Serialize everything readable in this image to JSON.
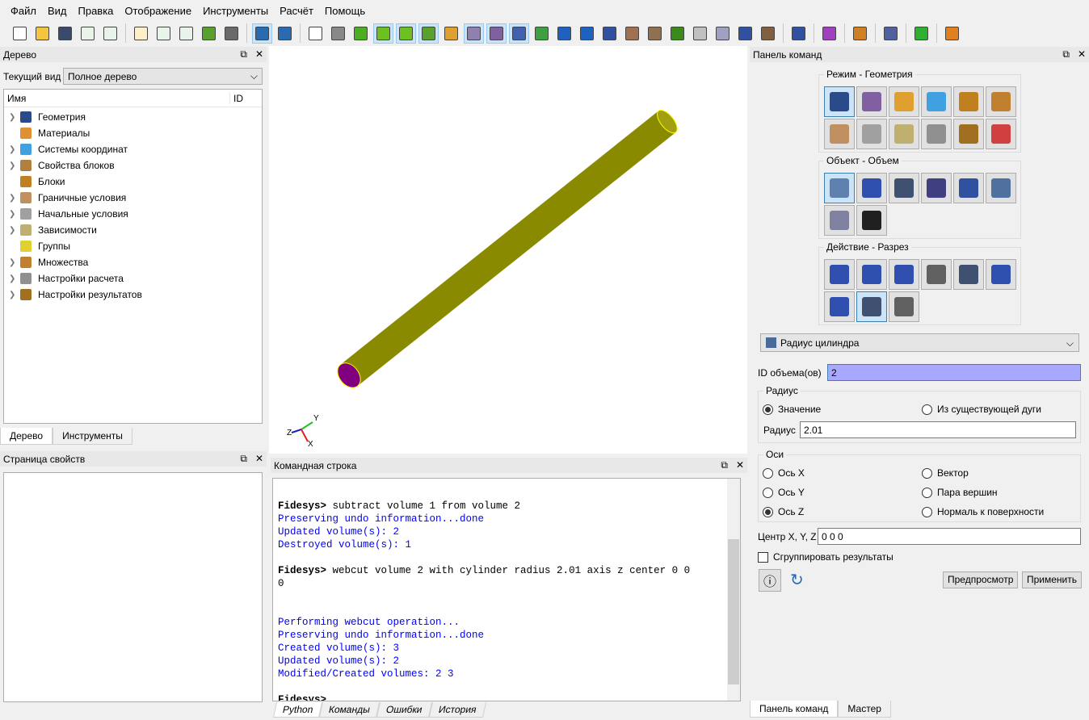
{
  "menu": [
    "Файл",
    "Вид",
    "Правка",
    "Отображение",
    "Инструменты",
    "Расчёт",
    "Помощь"
  ],
  "toolbar": {
    "icons": [
      {
        "name": "new-file-icon",
        "color": "#ffffff"
      },
      {
        "name": "open-folder-icon",
        "color": "#f5c542"
      },
      {
        "name": "save-icon",
        "color": "#3a4a6a"
      },
      {
        "name": "import-icon",
        "color": "#e8f4e8"
      },
      {
        "name": "export-icon",
        "color": "#e8f4e8"
      },
      "sep",
      {
        "name": "journal-edit-icon",
        "color": "#fdf0c8"
      },
      {
        "name": "play-journal-icon",
        "color": "#e8f4e8"
      },
      {
        "name": "id-journal-icon",
        "color": "#e8f4e8"
      },
      {
        "name": "pause-icon",
        "color": "#5aa02c"
      },
      {
        "name": "hammer-icon",
        "color": "#6a6a6a"
      },
      "sep",
      {
        "name": "undo-power-icon",
        "color": "#2a6ab0",
        "on": true
      },
      {
        "name": "undo-icon",
        "color": "#2a6ab0"
      },
      "sep",
      {
        "name": "wireframe-icon",
        "color": "#ffffff"
      },
      {
        "name": "hidden-line-icon",
        "color": "#888888"
      },
      {
        "name": "shaded-icon",
        "color": "#4caf20"
      },
      {
        "name": "volume-select-icon",
        "color": "#6cc020",
        "on": true
      },
      {
        "name": "geometry-icon",
        "color": "#6cc020",
        "on": true
      },
      {
        "name": "mesh-icon",
        "color": "#5aa02c",
        "on": true
      },
      {
        "name": "nodes-icon",
        "color": "#e0a030"
      },
      {
        "name": "grid-icon",
        "color": "#9080b0",
        "on": true
      },
      {
        "name": "box-select-icon",
        "color": "#8060a0",
        "on": true
      },
      {
        "name": "overlap-icon",
        "color": "#4060b0",
        "on": true
      },
      {
        "name": "refresh-icon",
        "color": "#40a040"
      },
      {
        "name": "zoom-in-icon",
        "color": "#2060c0"
      },
      {
        "name": "zoom-out-icon",
        "color": "#2060c0"
      },
      {
        "name": "fit-view-icon",
        "color": "#3050a0"
      },
      {
        "name": "block-icon",
        "color": "#a07050"
      },
      {
        "name": "ruler-icon",
        "color": "#907050"
      },
      {
        "name": "green-box-icon",
        "color": "#3a8a20"
      },
      {
        "name": "transparent-box-icon",
        "color": "#c0c0c0"
      },
      {
        "name": "cube-view-icon",
        "color": "#a0a0c0"
      },
      {
        "name": "sphere-icon",
        "color": "#3050a0"
      },
      {
        "name": "panel-icon",
        "color": "#806040"
      },
      "sep",
      {
        "name": "groups-icon",
        "color": "#3050a0"
      },
      "sep",
      {
        "name": "crosshair-icon",
        "color": "#a040c0"
      },
      "sep",
      {
        "name": "ground-icon",
        "color": "#d08020"
      },
      "sep",
      {
        "name": "bbox-icon",
        "color": "#5060a0"
      },
      "sep",
      {
        "name": "run-icon",
        "color": "#30b030"
      },
      "sep",
      {
        "name": "axis-z-icon",
        "color": "#e08020"
      }
    ]
  },
  "tree_panel": {
    "title": "Дерево",
    "current_view_label": "Текущий вид",
    "current_view_value": "Полное дерево",
    "col_name": "Имя",
    "col_id": "ID",
    "items": [
      {
        "label": "Геометрия",
        "exp": true,
        "icon": "geometry-icon",
        "color": "#2a4a8a"
      },
      {
        "label": "Материалы",
        "exp": false,
        "icon": "materials-icon",
        "color": "#e09030"
      },
      {
        "label": "Системы координат",
        "exp": true,
        "icon": "coordinate-system-icon",
        "color": "#40a0e0"
      },
      {
        "label": "Свойства блоков",
        "exp": true,
        "icon": "block-properties-icon",
        "color": "#b08040"
      },
      {
        "label": "Блоки",
        "exp": false,
        "icon": "blocks-icon",
        "color": "#c08020"
      },
      {
        "label": "Граничные условия",
        "exp": true,
        "icon": "boundary-conditions-icon",
        "color": "#c09060"
      },
      {
        "label": "Начальные условия",
        "exp": true,
        "icon": "initial-conditions-icon",
        "color": "#a0a0a0"
      },
      {
        "label": "Зависимости",
        "exp": true,
        "icon": "dependencies-icon",
        "color": "#c0b070"
      },
      {
        "label": "Группы",
        "exp": false,
        "icon": "groups-icon",
        "color": "#e0d030"
      },
      {
        "label": "Множества",
        "exp": true,
        "icon": "sets-icon",
        "color": "#c08030"
      },
      {
        "label": "Настройки расчета",
        "exp": true,
        "icon": "calc-settings-icon",
        "color": "#909090"
      },
      {
        "label": "Настройки результатов",
        "exp": true,
        "icon": "results-settings-icon",
        "color": "#a07020"
      }
    ],
    "tabs": [
      "Дерево",
      "Инструменты"
    ]
  },
  "properties_panel": {
    "title": "Страница свойств"
  },
  "viewport": {
    "axes": {
      "x": "X",
      "y": "Y",
      "z": "Z"
    },
    "cylinder_color": "#8a8a00",
    "cap_color": "#800080"
  },
  "command_line": {
    "title": "Командная строка",
    "lines": [
      {
        "t": "",
        "c": "out"
      },
      {
        "t": "Fidesys> ",
        "c": "cmd",
        "rest": "subtract volume 1 from volume 2"
      },
      {
        "t": "Preserving undo information...done",
        "c": "out"
      },
      {
        "t": "Updated volume(s): 2",
        "c": "out"
      },
      {
        "t": "Destroyed volume(s): 1",
        "c": "out"
      },
      {
        "t": "",
        "c": "out"
      },
      {
        "t": "Fidesys> ",
        "c": "cmd",
        "rest": "webcut volume 2 with cylinder radius 2.01 axis z center 0 0"
      },
      {
        "t": "0",
        "c": "plain"
      },
      {
        "t": "",
        "c": "out"
      },
      {
        "t": "",
        "c": "out"
      },
      {
        "t": "Performing webcut operation...",
        "c": "out"
      },
      {
        "t": "Preserving undo information...done",
        "c": "out"
      },
      {
        "t": "Created volume(s): 3",
        "c": "out"
      },
      {
        "t": "Updated volume(s): 2",
        "c": "out"
      },
      {
        "t": "Modified/Created volumes: 2 3",
        "c": "out"
      },
      {
        "t": "",
        "c": "out"
      },
      {
        "t": "Fidesys> ",
        "c": "cmd",
        "rest": ""
      }
    ],
    "tabs": [
      "Python",
      "Команды",
      "Ошибки",
      "История"
    ]
  },
  "command_panel": {
    "title": "Панель команд",
    "mode_label": "Режим - Геометрия",
    "object_label": "Объект - Объем",
    "action_label": "Действие - Разрез",
    "mode_icons": [
      {
        "name": "geometry-mode-icon",
        "color": "#2a4a8a",
        "on": true
      },
      {
        "name": "mesh-mode-icon",
        "color": "#8060a0"
      },
      {
        "name": "materials-mode-icon",
        "color": "#e0a030"
      },
      {
        "name": "coordinates-mode-icon",
        "color": "#40a0e0"
      },
      {
        "name": "blocks-mode-icon",
        "color": "#c08020"
      },
      {
        "name": "sets-mode-icon",
        "color": "#c08030"
      },
      {
        "name": "bc-mode-icon",
        "color": "#c09060"
      },
      {
        "name": "initial-mode-icon",
        "color": "#a0a0a0"
      },
      {
        "name": "dependency-mode-icon",
        "color": "#c0b070"
      },
      {
        "name": "calc-mode-icon",
        "color": "#909090"
      },
      {
        "name": "results-mode-icon",
        "color": "#a07020"
      },
      {
        "name": "inspect-mode-icon",
        "color": "#d04040"
      }
    ],
    "object_icons": [
      {
        "name": "volume-icon",
        "color": "#6080b0",
        "on": true
      },
      {
        "name": "surface-icon",
        "color": "#3050b0"
      },
      {
        "name": "curve-icon",
        "color": "#405070"
      },
      {
        "name": "vertex-icon",
        "color": "#404080"
      },
      {
        "name": "group-icon",
        "color": "#3050a0"
      },
      {
        "name": "body-icon",
        "color": "#5070a0"
      },
      {
        "name": "measure-icon",
        "color": "#8080a0"
      },
      {
        "name": "text-icon",
        "color": "#202020"
      }
    ],
    "action_icons": [
      {
        "name": "create-icon",
        "color": "#3050b0"
      },
      {
        "name": "modify-icon",
        "color": "#3050b0"
      },
      {
        "name": "transform-icon",
        "color": "#3050b0"
      },
      {
        "name": "copy-icon",
        "color": "#606060"
      },
      {
        "name": "delete-icon",
        "color": "#405070"
      },
      {
        "name": "imprint-icon",
        "color": "#3050b0"
      },
      {
        "name": "boolean-icon",
        "color": "#3050b0"
      },
      {
        "name": "webcut-icon",
        "color": "#405070",
        "on": true
      },
      {
        "name": "cleanup-icon",
        "color": "#606060"
      }
    ],
    "operation": "Радиус цилиндра",
    "volume_id_label": "ID объема(ов)",
    "volume_id_value": "2",
    "radius_group": "Радиус",
    "radius_value_option": "Значение",
    "radius_arc_option": "Из существующей дуги",
    "radius_label": "Радиус",
    "radius_value": "2.01",
    "axes_group": "Оси",
    "axis_options": [
      "Ось X",
      "Ось Y",
      "Ось Z",
      "Вектор",
      "Пара вершин",
      "Нормаль к поверхности"
    ],
    "selected_axis": "Ось Z",
    "center_label": "Центр X, Y, Z",
    "center_value": "0 0 0",
    "group_results_label": "Сгруппировать результаты",
    "group_results_checked": false,
    "preview_button": "Предпросмотр",
    "apply_button": "Применить",
    "tabs": [
      "Панель команд",
      "Мастер"
    ]
  }
}
